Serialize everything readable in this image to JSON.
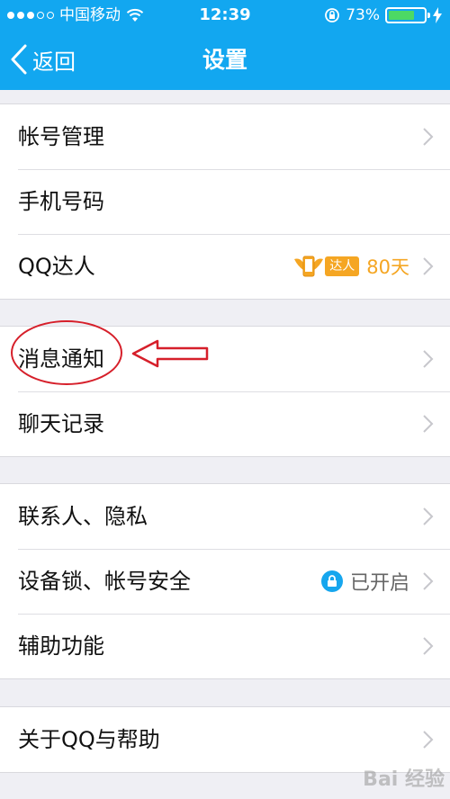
{
  "status_bar": {
    "carrier": "中国移动",
    "time": "12:39",
    "battery_percent": "73%",
    "battery_level": 0.73
  },
  "nav": {
    "back_label": "返回",
    "title": "设置"
  },
  "sections": {
    "account": {
      "account_manage": "帐号管理",
      "phone_number": "手机号码",
      "qq_daren": "QQ达人",
      "daren_badge": "达人",
      "daren_days": "80天"
    },
    "notify": {
      "message_notify": "消息通知",
      "chat_history": "聊天记录"
    },
    "privacy": {
      "contacts_privacy": "联系人、隐私",
      "device_lock": "设备锁、帐号安全",
      "device_lock_status": "已开启",
      "accessibility": "辅助功能"
    },
    "about": {
      "about_help": "关于QQ与帮助"
    }
  },
  "watermark": "Bai 经验",
  "colors": {
    "header": "#12a7f0",
    "badge": "#f5a623",
    "annotation": "#d61f2a"
  }
}
